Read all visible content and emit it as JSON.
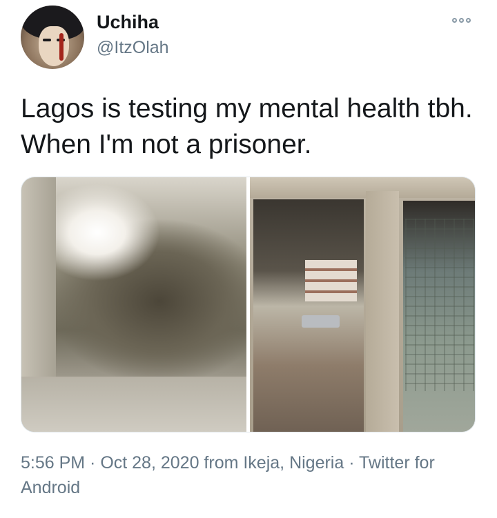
{
  "tweet": {
    "author_name": "Uchiha",
    "author_handle": "@ItzOlah",
    "text": "Lagos is testing my mental health tbh. When I'm not a prisoner.",
    "timestamp": "5:56 PM · Oct 28, 2020 from Ikeja, Nigeria · Twitter for Android"
  },
  "icons": {
    "more": "more-options-icon",
    "avatar": "avatar"
  },
  "colors": {
    "text_primary": "#14171a",
    "text_secondary": "#657786",
    "border": "#e1e8ed"
  }
}
